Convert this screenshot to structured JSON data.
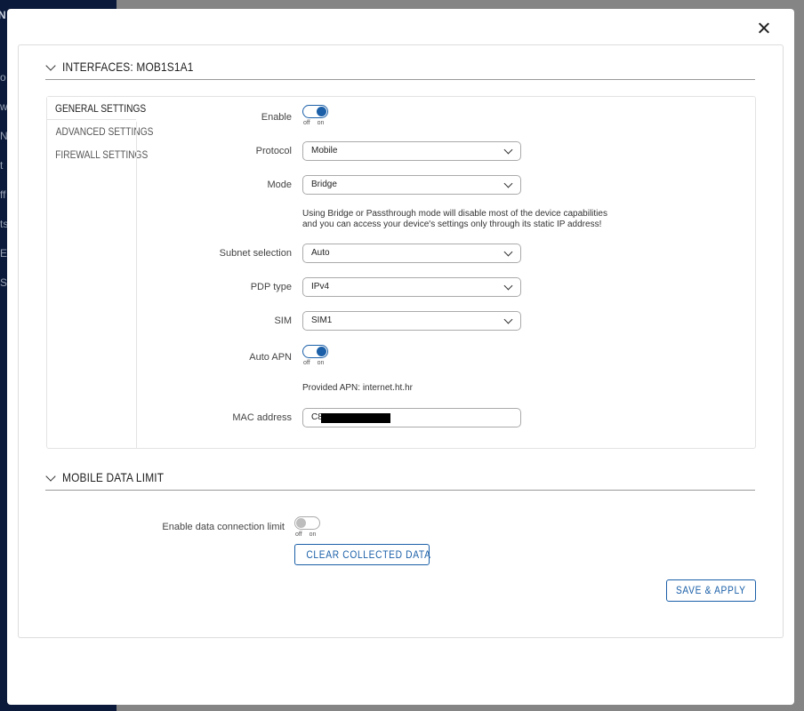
{
  "background": {
    "sidebar_fragments": [
      "N",
      "o",
      "w",
      "N",
      "t",
      "ff",
      "ts",
      "E",
      "S"
    ]
  },
  "dialog": {
    "close_label": "close"
  },
  "interfaces_section": {
    "title": "INTERFACES: MOB1S1A1",
    "tabs": [
      "GENERAL SETTINGS",
      "ADVANCED SETTINGS",
      "FIREWALL SETTINGS"
    ],
    "active_tab": "GENERAL SETTINGS",
    "fields": {
      "enable": {
        "label": "Enable",
        "state": "on",
        "off_label": "off",
        "on_label": "on"
      },
      "protocol": {
        "label": "Protocol",
        "value": "Mobile"
      },
      "mode": {
        "label": "Mode",
        "value": "Bridge"
      },
      "mode_note_line1": "Using Bridge or Passthrough mode will disable most of the device capabilities",
      "mode_note_line2": "and you can access your device's settings only through its static IP address!",
      "subnet_selection": {
        "label": "Subnet selection",
        "value": "Auto"
      },
      "pdp_type": {
        "label": "PDP type",
        "value": "IPv4"
      },
      "sim": {
        "label": "SIM",
        "value": "SIM1"
      },
      "auto_apn": {
        "label": "Auto APN",
        "state": "on",
        "off_label": "off",
        "on_label": "on"
      },
      "provided_apn": "Provided APN: internet.ht.hr",
      "mac_address": {
        "label": "MAC address",
        "value": "C8"
      }
    }
  },
  "mobile_data_section": {
    "title": "MOBILE DATA LIMIT",
    "enable_limit": {
      "label": "Enable data connection limit",
      "state": "off",
      "off_label": "off",
      "on_label": "on"
    },
    "clear_button": "CLEAR COLLECTED DATA"
  },
  "footer": {
    "save_apply": "SAVE & APPLY"
  },
  "colors": {
    "accent": "#1a5fa8",
    "sidebar": "#0b1a3a",
    "overlay": "#858585"
  }
}
